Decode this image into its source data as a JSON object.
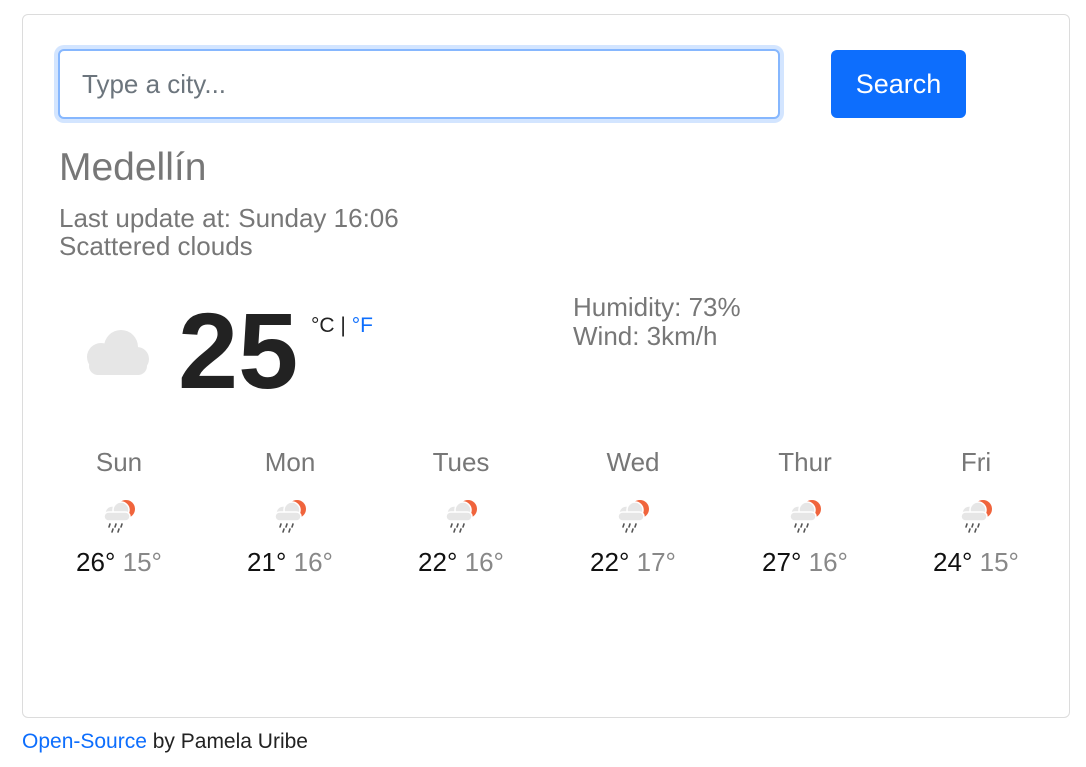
{
  "search": {
    "placeholder": "Type a city...",
    "value": "",
    "button_label": "Search"
  },
  "current": {
    "city": "Medellín",
    "last_update": "Last update at: Sunday 16:06",
    "description": "Scattered clouds",
    "icon": "cloud-icon",
    "temperature": "25",
    "unit_celsius": "°C",
    "unit_separator": "|",
    "unit_fahrenheit": "°F",
    "humidity": "Humidity: 73%",
    "wind": "Wind: 3km/h"
  },
  "forecast": [
    {
      "day": "Sun",
      "max": "26°",
      "min": "15°",
      "icon": "rain-sun-icon"
    },
    {
      "day": "Mon",
      "max": "21°",
      "min": "16°",
      "icon": "rain-sun-icon"
    },
    {
      "day": "Tues",
      "max": "22°",
      "min": "16°",
      "icon": "rain-sun-icon"
    },
    {
      "day": "Wed",
      "max": "22°",
      "min": "17°",
      "icon": "rain-sun-icon"
    },
    {
      "day": "Thur",
      "max": "27°",
      "min": "16°",
      "icon": "rain-sun-icon"
    },
    {
      "day": "Fri",
      "max": "24°",
      "min": "15°",
      "icon": "rain-sun-icon"
    }
  ],
  "footer": {
    "link_text": "Open-Source",
    "suffix": " by Pamela Uribe"
  },
  "colors": {
    "accent": "#0d6efd",
    "muted_text": "#777777",
    "sun": "#f0643c",
    "cloud": "#e6e6e6"
  }
}
